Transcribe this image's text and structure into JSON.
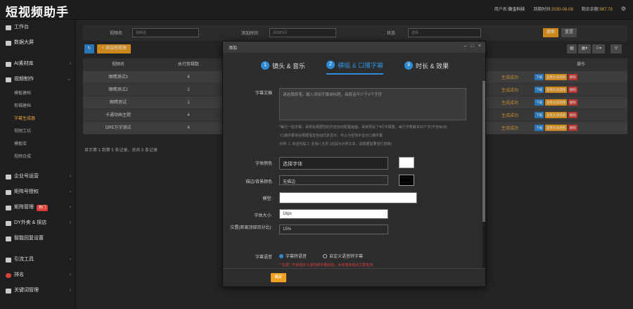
{
  "app": {
    "logo": "短视频助手"
  },
  "topbar": {
    "user_label": "用户名:",
    "user_value": "微金科技",
    "expire_label": "到期时间:",
    "expire_value": "2030-08-08",
    "balance_label": "剩余余额:",
    "balance_value": "987.78"
  },
  "sidebar": {
    "items": [
      {
        "label": "工作台"
      },
      {
        "label": "数据大屏"
      },
      {
        "label": "AI素材库"
      },
      {
        "label": "视频制作"
      },
      {
        "label": "企业号运营"
      },
      {
        "label": "矩阵号授权"
      },
      {
        "label": "矩阵管理",
        "badge": "热门"
      },
      {
        "label": "DY外卖 & 探店"
      },
      {
        "label": "智能回复设置"
      },
      {
        "label": "引流工具"
      },
      {
        "label": "排名"
      },
      {
        "label": "关键词管理"
      }
    ],
    "subitems": [
      {
        "label": "模板建档"
      },
      {
        "label": "剪辑建档"
      },
      {
        "label": "字幕生成器",
        "active": true
      },
      {
        "label": "视频工坊"
      },
      {
        "label": "模板库"
      },
      {
        "label": "视频合成"
      }
    ]
  },
  "filters": {
    "name_label": "视频名",
    "name_placeholder": "视频名",
    "time_label": "添加时间",
    "time_placeholder": "添加时间",
    "status_label": "状态",
    "status_value": "选择",
    "search_btn": "搜索",
    "reset_btn": "重置",
    "add_btn": "+ 添加短视频"
  },
  "table": {
    "headers": [
      "视频名",
      "执行剪辑数"
    ],
    "rows": [
      [
        "眼睛测试3",
        "4"
      ],
      [
        "眼睛测试2",
        "2"
      ],
      [
        "眼睛测试",
        "1"
      ],
      [
        "卡通动画主题",
        "4"
      ],
      [
        "OPE万字测试",
        "4"
      ]
    ],
    "pager": "显示第 1 到第 5 条记录，总共 5 条记录"
  },
  "right_table": {
    "headers": [
      "",
      "操作"
    ],
    "rows": [
      {
        "status": "生成成功"
      },
      {
        "status": "生成成功"
      },
      {
        "status": "生成成功"
      },
      {
        "status": "生成成功"
      },
      {
        "status": "生成成功"
      }
    ],
    "op_labels": [
      "下载",
      "查看生成视频",
      "删除"
    ]
  },
  "modal": {
    "title": "添加",
    "steps": [
      {
        "num": "1",
        "label": "镜头 & 音乐"
      },
      {
        "num": "2",
        "label": "横幅 & 口播字幕"
      },
      {
        "num": "3",
        "label": "时长 & 效果"
      }
    ],
    "caption_label": "字幕文稿",
    "caption_placeholder": "请选择段落，输入添加字幕或标题，每段话不少于X个字符",
    "hint1": "*每行一段字幕，系统会根据您的内容自动配置画面，系统预设了4行字幕数，每行字数最多20个字(不含标点)",
    "hint2": "*口播字幕将会根据语音自动同步显示，可以为空则不显示口播字幕",
    "hint3": "示例: 1. 欢迎光临 2. 全场八五折 (这段为示例文本，请根据需要自行替换)",
    "font_label": "字体颜色",
    "font_value": "选择字体",
    "bg_label": "描边/背景颜色",
    "bg_value": "无描边",
    "model_label": "模型:",
    "size_label": "字体大小:",
    "size_value": "18px",
    "pos_label": "位置(距离顶部百分比):",
    "pos_value": "15%",
    "voice_label": "字幕语音",
    "voice_opt1": "字幕转语音",
    "voice_opt2": "自定义语音转字幕",
    "warn": "*\"注意\": 开启自定义语音转字幕功能，会考虑多镜头文案失效",
    "confirm": "确定"
  },
  "colors": {
    "accent": "#f0a020",
    "primary": "#2f8bd6",
    "danger": "#d9403a"
  }
}
